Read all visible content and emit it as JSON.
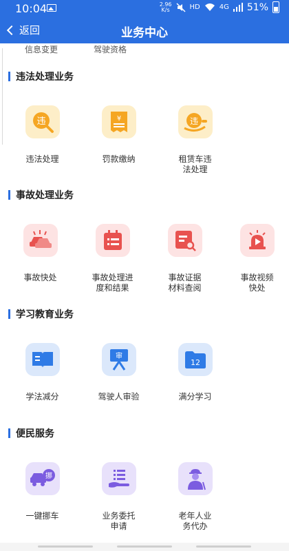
{
  "status_bar": {
    "time": "10:04",
    "speed_value": "2.96",
    "speed_unit": "K/s",
    "hd": "HD",
    "network": "4G",
    "battery": "51%"
  },
  "nav": {
    "back_label": "返回",
    "title": "业务中心"
  },
  "cut_items": [
    "信息变更",
    "驾驶资格"
  ],
  "sections": [
    {
      "title": "违法处理业务",
      "items": [
        {
          "label": "违法处理",
          "icon": "violation-search-icon"
        },
        {
          "label": "罚款缴纳",
          "icon": "fine-receipt-icon"
        },
        {
          "label": "租赁车违\n法处理",
          "icon": "rental-violation-icon"
        }
      ]
    },
    {
      "title": "事故处理业务",
      "items": [
        {
          "label": "事故快处",
          "icon": "car-crash-icon"
        },
        {
          "label": "事故处理进\n度和结果",
          "icon": "calendar-list-icon"
        },
        {
          "label": "事故证据\n材料查阅",
          "icon": "document-search-icon"
        },
        {
          "label": "事故视频\n快处",
          "icon": "siren-video-icon"
        }
      ]
    },
    {
      "title": "学习教育业务",
      "items": [
        {
          "label": "学法减分",
          "icon": "open-book-icon"
        },
        {
          "label": "驾驶人审验",
          "icon": "review-board-icon"
        },
        {
          "label": "满分学习",
          "icon": "folder-12-icon"
        }
      ]
    },
    {
      "title": "便民服务",
      "items": [
        {
          "label": "一键挪车",
          "icon": "move-car-icon"
        },
        {
          "label": "业务委托\n申请",
          "icon": "hand-list-icon"
        },
        {
          "label": "老年人业\n务代办",
          "icon": "elderly-person-icon"
        }
      ]
    }
  ],
  "icon_text": {
    "violation": "违",
    "move": "挪",
    "review": "审",
    "full_score": "12"
  },
  "colors": {
    "primary": "#2b6fe0",
    "orange": "#f5a623",
    "red": "#e8524f",
    "blue": "#2f7be6",
    "purple": "#7b5ce0"
  }
}
